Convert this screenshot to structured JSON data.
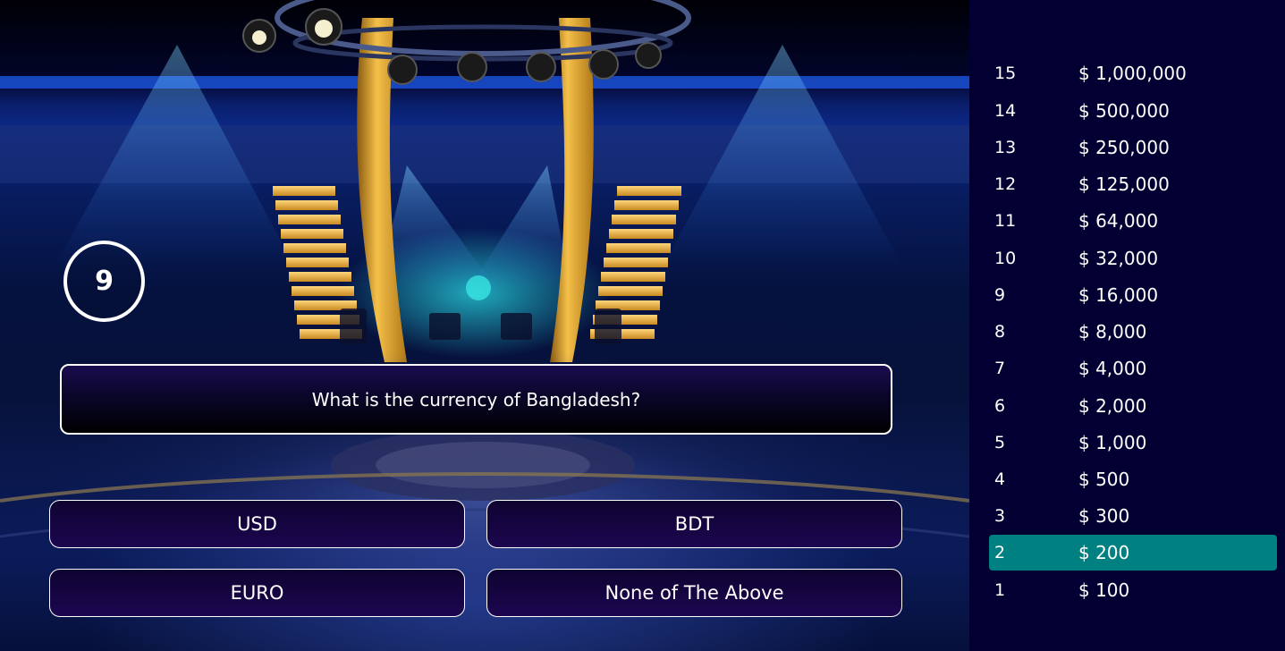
{
  "question_number": "9",
  "question": "What is the currency of Bangladesh?",
  "answers": [
    "USD",
    "BDT",
    "EURO",
    "None of The Above"
  ],
  "ladder": [
    {
      "level": "15",
      "amount": "$ 1,000,000"
    },
    {
      "level": "14",
      "amount": "$ 500,000"
    },
    {
      "level": "13",
      "amount": "$ 250,000"
    },
    {
      "level": "12",
      "amount": "$ 125,000"
    },
    {
      "level": "11",
      "amount": "$ 64,000"
    },
    {
      "level": "10",
      "amount": "$ 32,000"
    },
    {
      "level": "9",
      "amount": "$ 16,000"
    },
    {
      "level": "8",
      "amount": "$ 8,000"
    },
    {
      "level": "7",
      "amount": "$ 4,000"
    },
    {
      "level": "6",
      "amount": "$ 2,000"
    },
    {
      "level": "5",
      "amount": "$ 1,000"
    },
    {
      "level": "4",
      "amount": "$ 500"
    },
    {
      "level": "3",
      "amount": "$ 300"
    },
    {
      "level": "2",
      "amount": "$ 200"
    },
    {
      "level": "1",
      "amount": "$ 100"
    }
  ],
  "active_level": "2",
  "colors": {
    "background": "#020033",
    "active_rung": "#008080",
    "answer_fill": "#1c0650"
  }
}
